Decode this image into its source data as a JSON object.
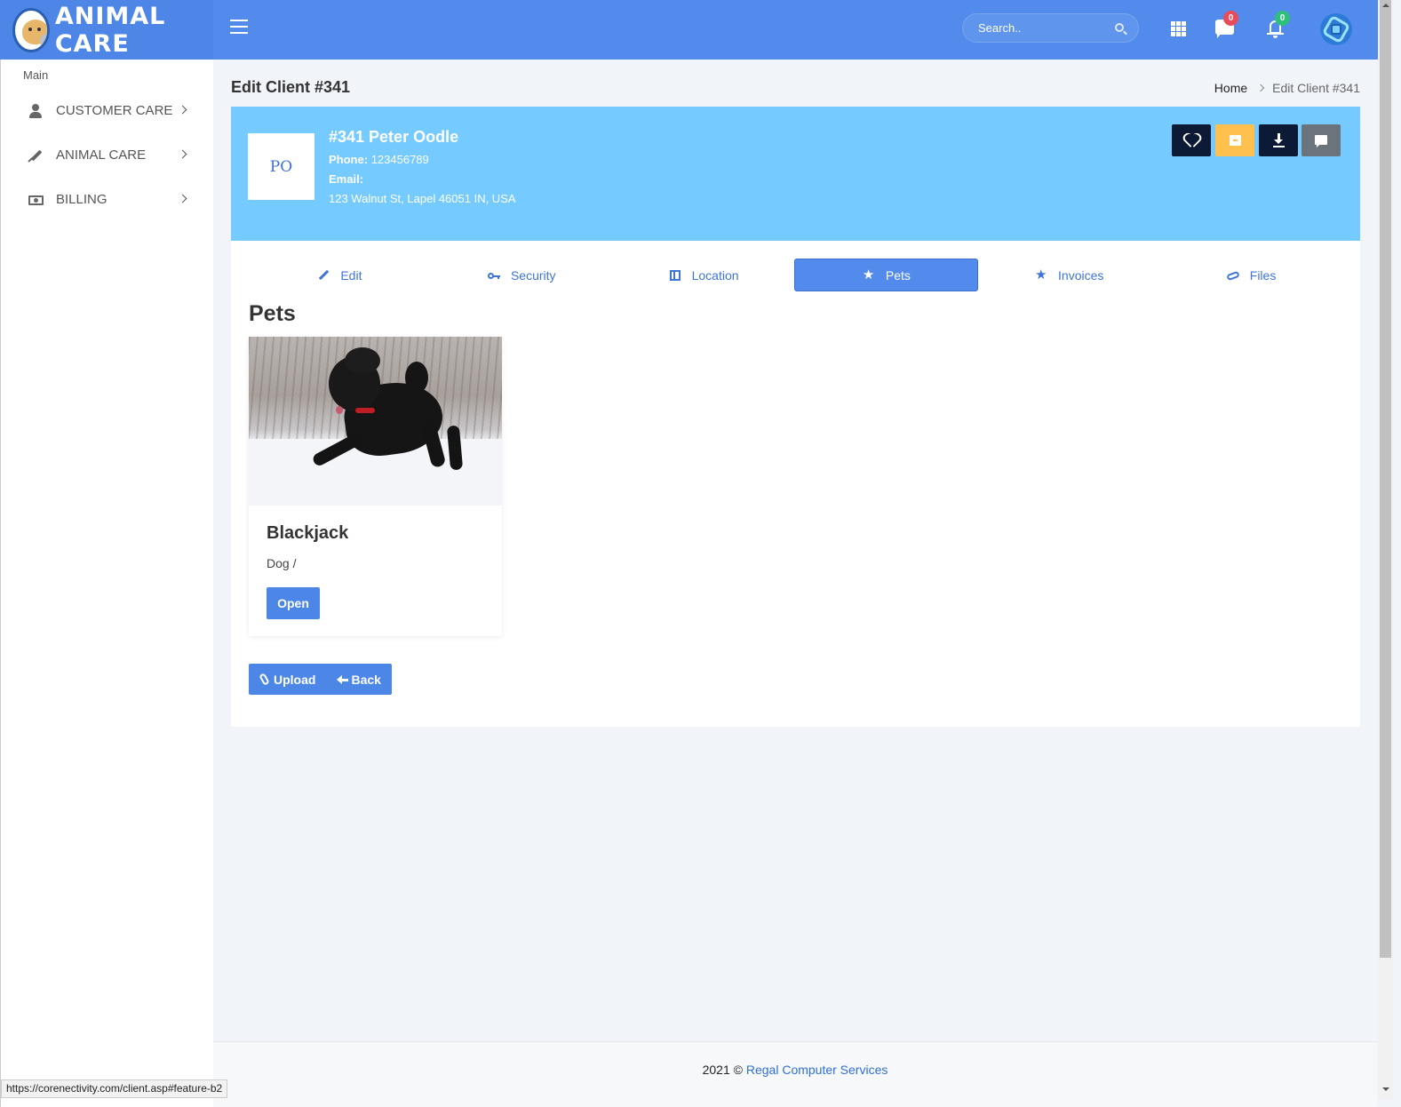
{
  "header": {
    "logo_text": "ANIMAL CARE",
    "search_placeholder": "Search..",
    "messages_count": "0",
    "notifications_count": "0"
  },
  "sidebar": {
    "section_label": "Main",
    "items": [
      {
        "label": "CUSTOMER CARE",
        "icon": "user-icon"
      },
      {
        "label": "ANIMAL CARE",
        "icon": "syringe-icon"
      },
      {
        "label": "BILLING",
        "icon": "money-icon"
      }
    ]
  },
  "page": {
    "title": "Edit Client #341",
    "breadcrumb": [
      "Home",
      "Edit Client #341"
    ]
  },
  "client": {
    "initials": "PO",
    "name": "#341 Peter Oodle",
    "phone_label": "Phone:",
    "phone": "123456789",
    "email_label": "Email:",
    "email": "",
    "address": "123 Walnut St, Lapel 46051 IN, USA",
    "actions": [
      "heart-icon",
      "archive-icon",
      "download-icon",
      "comment-icon"
    ]
  },
  "tabs": [
    {
      "label": "Edit",
      "icon": "pencil-icon",
      "active": false
    },
    {
      "label": "Security",
      "icon": "key-icon",
      "active": false
    },
    {
      "label": "Location",
      "icon": "map-icon",
      "active": false
    },
    {
      "label": "Pets",
      "icon": "star-icon",
      "active": true
    },
    {
      "label": "Invoices",
      "icon": "star-icon",
      "active": false
    },
    {
      "label": "Files",
      "icon": "paperclip-icon",
      "active": false
    }
  ],
  "pets_section": {
    "heading": "Pets",
    "pets": [
      {
        "name": "Blackjack",
        "type": "Dog /",
        "open_label": "Open"
      }
    ],
    "upload_label": "Upload",
    "back_label": "Back"
  },
  "footer": {
    "year_text": "2021 © ",
    "company": "Regal Computer Services"
  },
  "status_url": "https://corenectivity.com/client.asp#feature-b2",
  "colors": {
    "topbar": "#528beb",
    "banner": "#75cbff",
    "accent": "#4c87e8",
    "archive": "#ffc04d",
    "dark": "#0d1a35"
  }
}
